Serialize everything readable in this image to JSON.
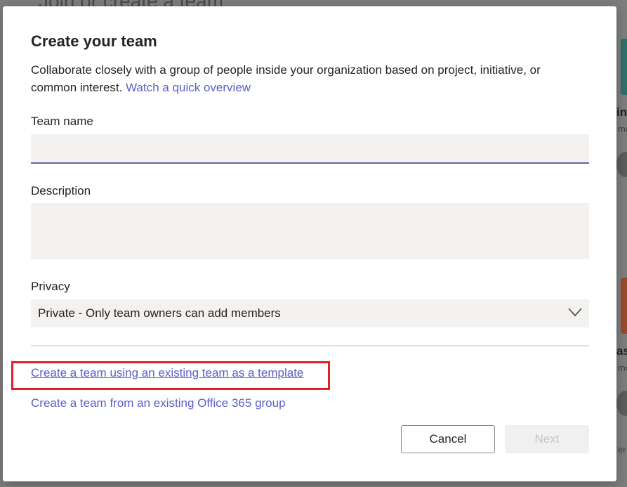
{
  "background": {
    "heading": "Join or create a team",
    "card_titles": [
      "in",
      "as"
    ],
    "card_subtitles": [
      "me",
      "me",
      "er"
    ]
  },
  "dialog": {
    "title": "Create your team",
    "intro_text": "Collaborate closely with a group of people inside your organization based on project, initiative, or common interest.",
    "intro_link": "Watch a quick overview",
    "team_name_label": "Team name",
    "team_name_value": "",
    "description_label": "Description",
    "description_value": "",
    "privacy_label": "Privacy",
    "privacy_selected": "Private - Only team owners can add members",
    "template_link": "Create a team using an existing team as a template",
    "o365_link": "Create a team from an existing Office 365 group",
    "cancel_label": "Cancel",
    "next_label": "Next"
  },
  "colors": {
    "accent": "#5b5fc7",
    "highlight": "#e0202b",
    "input_bg": "#f3f2f1"
  },
  "icons": {
    "privacy_dropdown": "chevron-down-icon"
  }
}
